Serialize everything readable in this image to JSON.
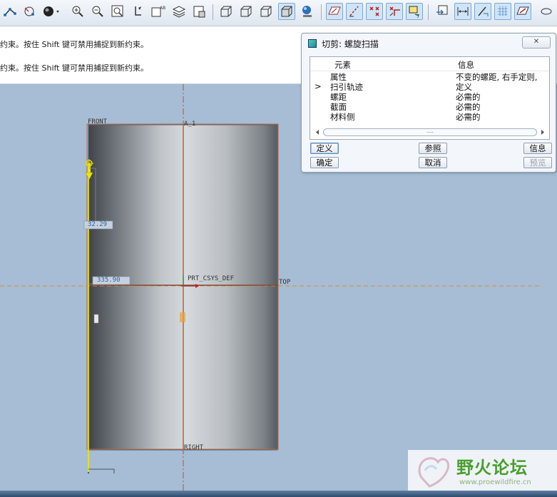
{
  "message_area": {
    "line1": "约束。按住 Shift 键可禁用捕捉到新约束。",
    "line2": "约束。按住 Shift 键可禁用捕捉到新约束。"
  },
  "sketch": {
    "label_front": "FRONT",
    "label_a1": "A_1",
    "label_prt_csys": "PRT_CSYS_DEF",
    "label_top": "TOP",
    "label_right": "RIGHT",
    "dim_vertical": "32.29",
    "dim_horizontal": "335.90"
  },
  "dialog": {
    "title": "切剪: 螺旋扫描",
    "close_label": "✕",
    "col_element": "元素",
    "col_info": "信息",
    "rows": [
      {
        "marker": "",
        "element": "属性",
        "info": "不变的螺距, 右手定则,"
      },
      {
        "marker": ">",
        "element": "扫引轨迹",
        "info": "定义"
      },
      {
        "marker": "",
        "element": "螺距",
        "info": "必需的"
      },
      {
        "marker": "",
        "element": "截面",
        "info": "必需的"
      },
      {
        "marker": "",
        "element": "材料侧",
        "info": "必需的"
      }
    ],
    "scroll_grip": "....",
    "btn_define": "定义",
    "btn_refs": "参照",
    "btn_info": "信息",
    "btn_ok": "确定",
    "btn_cancel": "取消",
    "btn_preview": "预览"
  },
  "watermark": {
    "text": "野火论坛",
    "url": "www.proewildfire.cn"
  },
  "colors": {
    "canvas_bg": "#a6bdd5",
    "centerline": "#d04a1a",
    "sketch_yellow": "#f2e600",
    "dim_blue": "#2f5fa8"
  }
}
